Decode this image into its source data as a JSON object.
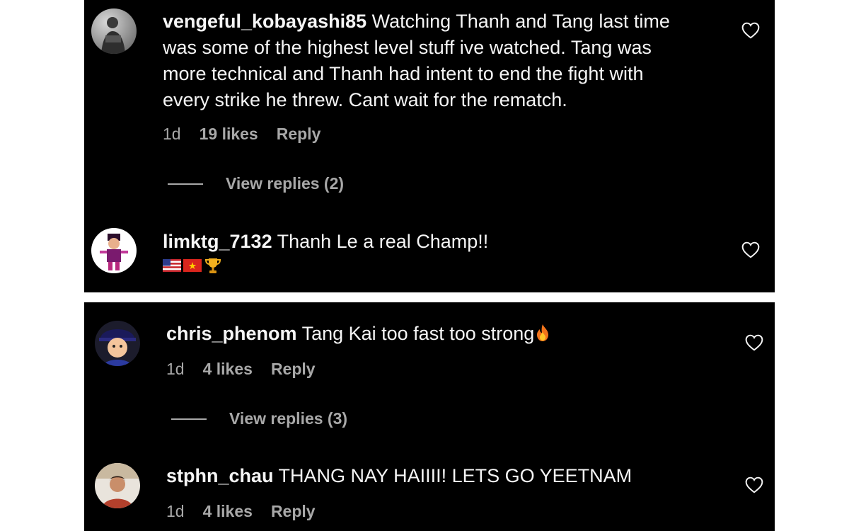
{
  "comments": [
    {
      "username": "vengeful_kobayashi85",
      "text_lines": [
        "Watching Thanh and Tang last time",
        "was some of the highest level stuff ive watched. Tang was",
        "more technical and Thanh had intent to end the fight with",
        "every strike he threw. Cant wait for the rematch."
      ],
      "time": "1d",
      "likes": "19 likes",
      "reply": "Reply",
      "view_replies": "View replies (2)",
      "avatar_icon": "person-gray-avatar"
    },
    {
      "username": "limktg_7132",
      "text": "Thanh Le a real Champ!!",
      "emoji": [
        "us-flag-emoji",
        "vietnam-flag-emoji",
        "trophy-emoji"
      ],
      "avatar_icon": "cartoon-character-avatar"
    },
    {
      "username": "chris_phenom",
      "text": "Tang Kai too fast too strong",
      "emoji": [
        "fire-emoji"
      ],
      "time": "1d",
      "likes": "4 likes",
      "reply": "Reply",
      "view_replies": "View replies (3)",
      "avatar_icon": "anime-boy-avatar"
    },
    {
      "username": "stphn_chau",
      "text": "THANG NAY HAIIII! LETS GO YEETNAM",
      "time": "1d",
      "likes": "4 likes",
      "reply": "Reply",
      "avatar_icon": "person-photo-avatar"
    }
  ],
  "colors": {
    "background": "#000000",
    "text": "#f5f5f5",
    "secondary": "#a8a8a8"
  }
}
